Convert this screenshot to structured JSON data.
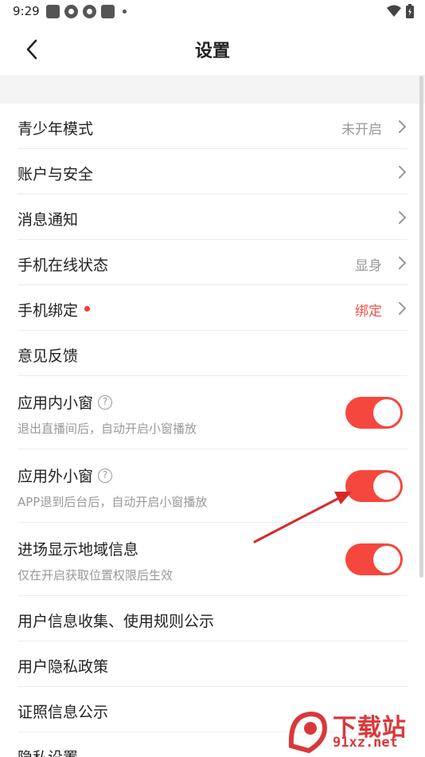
{
  "status_bar": {
    "time": "9:29"
  },
  "header": {
    "title": "设置"
  },
  "settings": {
    "teen_mode": {
      "label": "青少年模式",
      "value": "未开启"
    },
    "account_security": {
      "label": "账户与安全"
    },
    "notifications": {
      "label": "消息通知"
    },
    "online_status": {
      "label": "手机在线状态",
      "value": "显身"
    },
    "phone_binding": {
      "label": "手机绑定",
      "value": "绑定"
    },
    "feedback": {
      "label": "意见反馈"
    },
    "in_app_window": {
      "label": "应用内小窗",
      "sub": "退出直播间后，自动开启小窗播放",
      "enabled": true
    },
    "out_app_window": {
      "label": "应用外小窗",
      "sub": "APP退到后台后，自动开启小窗播放",
      "enabled": true
    },
    "region_display": {
      "label": "进场显示地域信息",
      "sub": "仅在开启获取位置权限后生效",
      "enabled": true
    },
    "user_info_rules": {
      "label": "用户信息收集、使用规则公示"
    },
    "privacy_policy": {
      "label": "用户隐私政策"
    },
    "license_info": {
      "label": "证照信息公示"
    },
    "privacy_settings": {
      "label": "隐私设置"
    }
  },
  "colors": {
    "accent": "#f5473d",
    "value_gray": "#999999",
    "value_red": "#f0524a"
  },
  "watermark": {
    "title": "下载站",
    "url": "91xz.net"
  }
}
